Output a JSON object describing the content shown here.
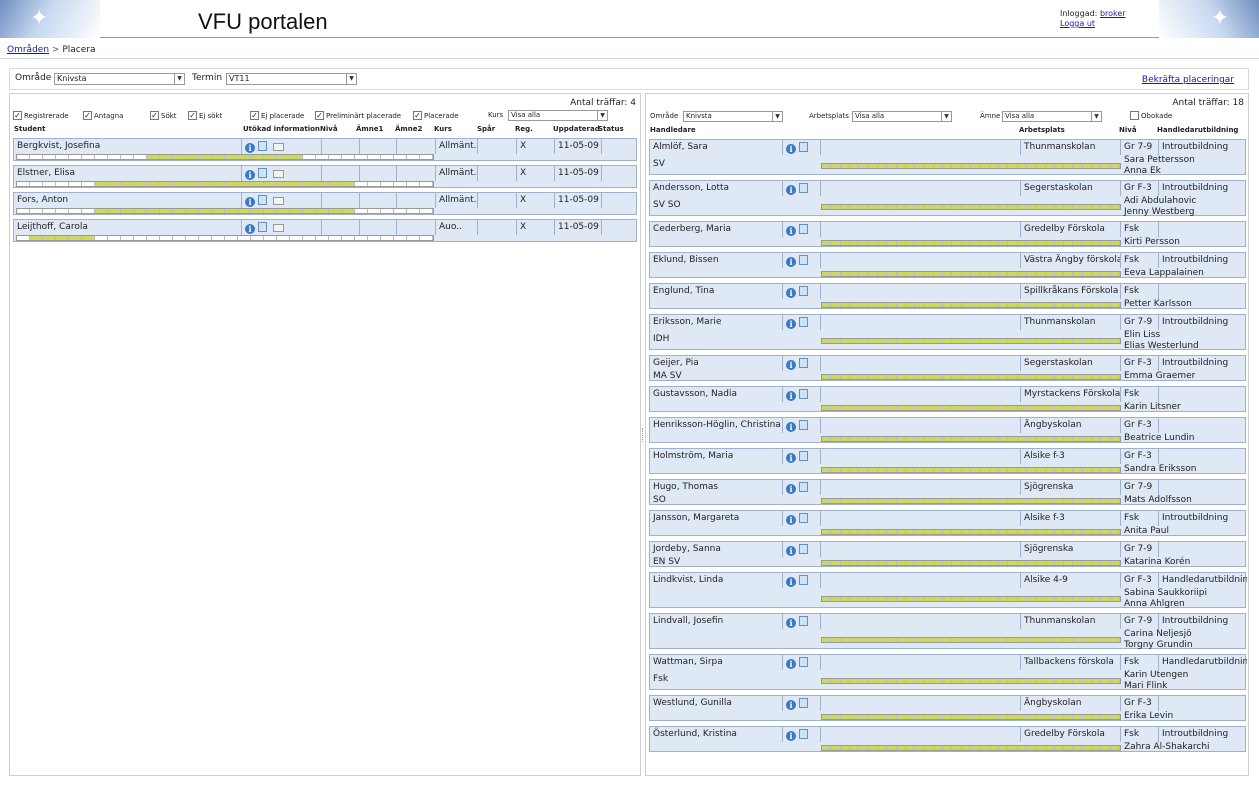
{
  "header": {
    "title": "VFU portalen",
    "logged_in_label": "Inloggad:",
    "user": "broker",
    "logout": "Logga ut"
  },
  "breadcrumb": {
    "link": "Områden",
    "separator": ">",
    "current": "Placera"
  },
  "filter": {
    "area_label": "Område",
    "area_value": "Knivsta",
    "term_label": "Termin",
    "term_value": "VT11",
    "confirm": "Bekräfta placeringar"
  },
  "left": {
    "count": "Antal träffar: 4",
    "checkboxes": [
      {
        "label": "Registrerade",
        "checked": true
      },
      {
        "label": "Antagna",
        "checked": true
      },
      {
        "label": "Sökt",
        "checked": true
      },
      {
        "label": "Ej sökt",
        "checked": true
      },
      {
        "label": "Ej placerade",
        "checked": true
      },
      {
        "label": "Preliminärt placerade",
        "checked": true
      },
      {
        "label": "Placerade",
        "checked": true
      }
    ],
    "course_label": "Kurs",
    "course_value": "Visa alla",
    "columns": [
      "Student",
      "Utökad information",
      "Nivå",
      "Ämne1",
      "Ämne2",
      "Kurs",
      "Spår",
      "Reg.",
      "Uppdaterad",
      "Status"
    ],
    "rows": [
      {
        "name": "Bergkvist, Josefina",
        "kurs": "Allmänt..",
        "reg": "X",
        "date": "11-05-09",
        "fill": [
          10,
          22
        ]
      },
      {
        "name": "Elstner, Elisa",
        "kurs": "Allmänt..",
        "reg": "X",
        "date": "11-05-09",
        "fill": [
          6,
          26
        ]
      },
      {
        "name": "Fors, Anton",
        "kurs": "Allmänt..",
        "reg": "X",
        "date": "11-05-09",
        "fill": [
          6,
          26
        ]
      },
      {
        "name": "Leijthoff, Carola",
        "kurs": "Auo..",
        "reg": "X",
        "date": "11-05-09",
        "fill": [
          1,
          6
        ]
      }
    ]
  },
  "right": {
    "count": "Antal träffar: 18",
    "area_label": "Område",
    "area_value": "Knivsta",
    "workplace_label": "Arbetsplats",
    "workplace_value": "Visa alla",
    "subject_label": "Ämne",
    "subject_value": "Visa alla",
    "unbooked_label": "Obokade",
    "columns": [
      "Handledare",
      "Arbetsplats",
      "Nivå",
      "Handledarutbildning"
    ],
    "rows": [
      {
        "name": "Almlöf, Sara",
        "place": "Thunmanskolan",
        "level": "Gr 7-9",
        "edu": "Introutbildning",
        "subj": "SV",
        "students": [
          "Sara Pettersson",
          "Anna Ek"
        ]
      },
      {
        "name": "Andersson, Lotta",
        "place": "Segerstaskolan",
        "level": "Gr F-3",
        "edu": "Introutbildning",
        "subj": "SV SO",
        "students": [
          "Adi Abdulahovic",
          "Jenny Westberg"
        ]
      },
      {
        "name": "Cederberg, Maria",
        "place": "Gredelby Förskola",
        "level": "Fsk",
        "edu": "",
        "subj": "",
        "students": [
          "Kirti Persson"
        ]
      },
      {
        "name": "Eklund, Bissen",
        "place": "Västra Ängby förskola",
        "level": "Fsk",
        "edu": "Introutbildning",
        "subj": "",
        "students": [
          "Eeva Lappalainen"
        ]
      },
      {
        "name": "Englund, Tina",
        "place": "Spillkråkans Förskola",
        "level": "Fsk",
        "edu": "",
        "subj": "",
        "students": [
          "Petter Karlsson"
        ]
      },
      {
        "name": "Eriksson, Marie",
        "place": "Thunmanskolan",
        "level": "Gr 7-9",
        "edu": "Introutbildning",
        "subj": "IDH",
        "students": [
          "Elin Liss",
          "Elias Westerlund"
        ]
      },
      {
        "name": "Geijer, Pia",
        "place": "Segerstaskolan",
        "level": "Gr F-3",
        "edu": "Introutbildning",
        "subj": "MA SV",
        "students": [
          "Emma Graemer"
        ]
      },
      {
        "name": "Gustavsson, Nadia",
        "place": "Myrstackens Förskola",
        "level": "Fsk",
        "edu": "",
        "subj": "",
        "students": [
          "Karin Litsner"
        ]
      },
      {
        "name": "Henriksson-Höglin, Christina",
        "place": "Ängbyskolan",
        "level": "Gr F-3",
        "edu": "",
        "subj": "",
        "students": [
          "Beatrice Lundin"
        ]
      },
      {
        "name": "Holmström, Maria",
        "place": "Alsike f-3",
        "level": "Gr F-3",
        "edu": "",
        "subj": "",
        "students": [
          "Sandra Eriksson"
        ]
      },
      {
        "name": "Hugo, Thomas",
        "place": "Sjögrenska",
        "level": "Gr 7-9",
        "edu": "",
        "subj": "SO",
        "students": [
          "Mats Adolfsson"
        ]
      },
      {
        "name": "Jansson, Margareta",
        "place": "Alsike f-3",
        "level": "Fsk",
        "edu": "Introutbildning",
        "subj": "",
        "students": [
          "Anita Paul"
        ]
      },
      {
        "name": "Jordeby, Sanna",
        "place": "Sjögrenska",
        "level": "Gr 7-9",
        "edu": "",
        "subj": "EN SV",
        "students": [
          "Katarina Korén"
        ]
      },
      {
        "name": "Lindkvist, Linda",
        "place": "Alsike 4-9",
        "level": "Gr F-3",
        "edu": "Handledarutbildning",
        "subj": "",
        "students": [
          "Sabina Saukkoriipi",
          "Anna Ahlgren"
        ]
      },
      {
        "name": "Lindvall, Josefin",
        "place": "Thunmanskolan",
        "level": "Gr 7-9",
        "edu": "Introutbildning",
        "subj": "",
        "students": [
          "Carina Neljesjö",
          "Torgny Grundin"
        ]
      },
      {
        "name": "Wattman, Sirpa",
        "place": "Tallbackens förskola",
        "level": "Fsk",
        "edu": "Handledarutbildning",
        "subj": "Fsk",
        "students": [
          "Karin Utengen",
          "Mari Flink"
        ]
      },
      {
        "name": "Westlund, Gunilla",
        "place": "Ängbyskolan",
        "level": "Gr F-3",
        "edu": "",
        "subj": "",
        "students": [
          "Erika Levin"
        ]
      },
      {
        "name": "Österlund, Kristina",
        "place": "Gredelby Förskola",
        "level": "Fsk",
        "edu": "Introutbildning",
        "subj": "",
        "students": [
          "Zahra Al-Shakarchi"
        ]
      }
    ]
  }
}
